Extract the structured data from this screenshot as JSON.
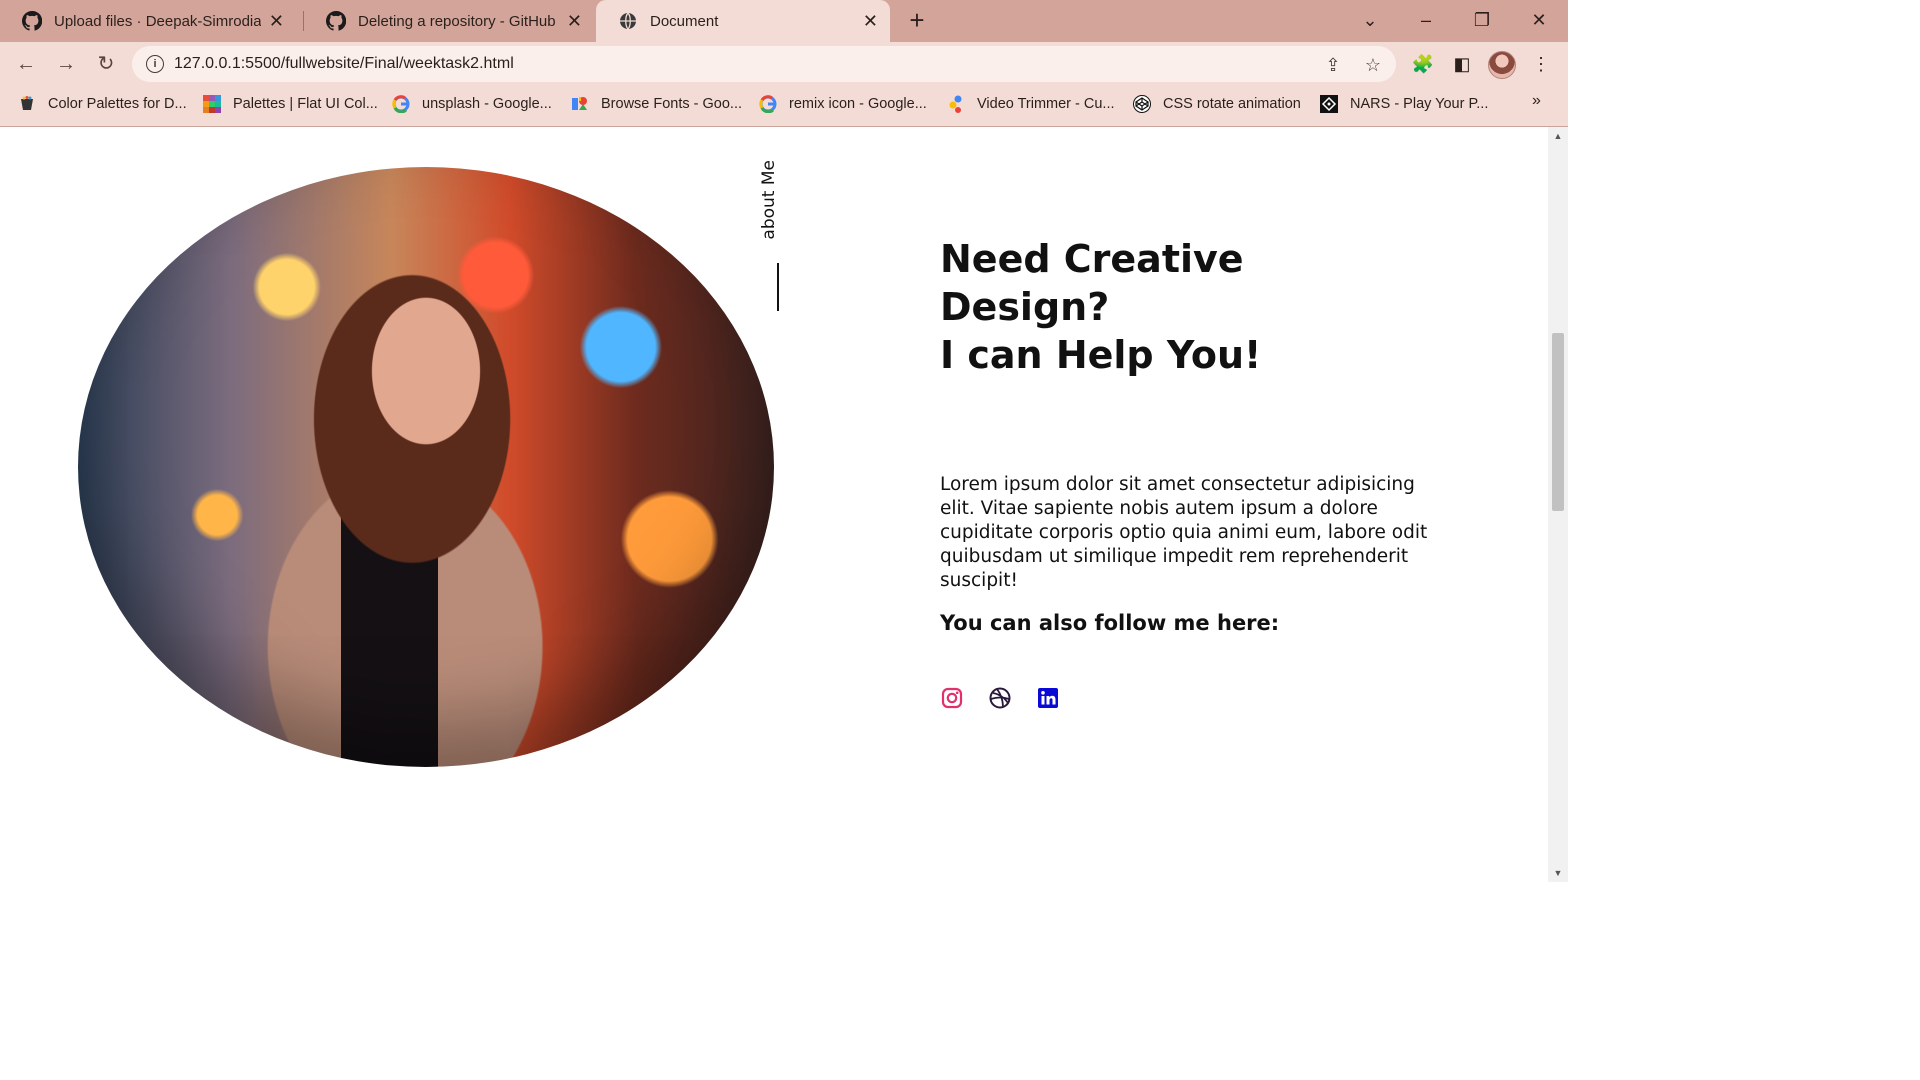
{
  "browser": {
    "tabs": [
      {
        "title": "Upload files · Deepak-Simrodia/w",
        "icon": "github-icon",
        "active": false
      },
      {
        "title": "Deleting a repository - GitHub D",
        "icon": "github-icon",
        "active": false
      },
      {
        "title": "Document",
        "icon": "globe-icon",
        "active": true
      }
    ],
    "url": "127.0.0.1:5500/fullwebsite/Final/weektask2.html",
    "bookmarks": [
      {
        "label": "Color Palettes for D...",
        "icon": "palette-cup-icon"
      },
      {
        "label": "Palettes | Flat UI Col...",
        "icon": "flat-ui-icon"
      },
      {
        "label": "unsplash - Google...",
        "icon": "google-icon"
      },
      {
        "label": "Browse Fonts - Goo...",
        "icon": "google-fonts-icon"
      },
      {
        "label": "remix icon - Google...",
        "icon": "google-icon"
      },
      {
        "label": "Video Trimmer - Cu...",
        "icon": "video-trimmer-icon"
      },
      {
        "label": "CSS rotate animation",
        "icon": "codepen-icon"
      },
      {
        "label": "NARS - Play Your P...",
        "icon": "nars-icon"
      }
    ]
  },
  "page": {
    "side_label": "about Me",
    "headline_line1": "Need Creative",
    "headline_line2": "Design?",
    "headline_line3": "I can Help You!",
    "bio": "Lorem ipsum dolor sit amet consectetur adipisicing elit. Vitae sapiente nobis autem ipsum a dolore cupiditate corporis optio quia animi eum, labore odit quibusdam ut similique impedit rem reprehenderit suscipit!",
    "follow_heading": "You can also follow me here:",
    "social": [
      {
        "name": "instagram-icon",
        "color": "#e1306c"
      },
      {
        "name": "dribbble-icon",
        "color": "#2a1a3a"
      },
      {
        "name": "linkedin-icon",
        "color": "#0a0ad6"
      }
    ]
  },
  "colors": {
    "tabstrip": "#d3a59a",
    "toolbar": "#f3dcd6"
  }
}
